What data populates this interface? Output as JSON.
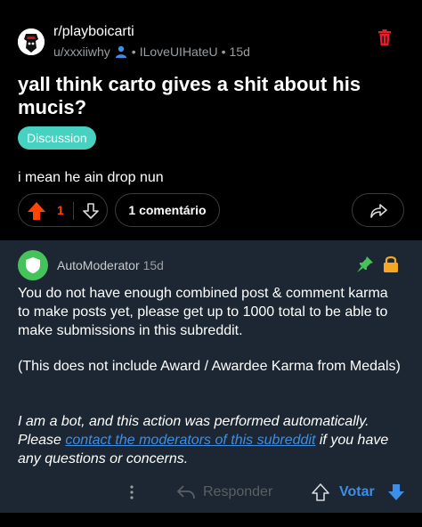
{
  "colors": {
    "background": "#000000",
    "comment_bg": "#1c2733",
    "upvote": "#ff4500",
    "flair": "#46d1c0",
    "link": "#3d8ee6",
    "trash": "#e0202a",
    "mod_avatar": "#46c25b",
    "pin": "#46c25b",
    "lock": "#f5a623"
  },
  "post": {
    "subreddit": "r/playboicarti",
    "author": "u/xxxiiwhy",
    "user_flair": "ILoveUIHateU",
    "age": "15d",
    "title": "yall think carto gives a shit about his mucis?",
    "flair": "Discussion",
    "body": "i mean he ain drop nun",
    "score": "1",
    "comments_label": "1 comentário",
    "icons": {
      "subreddit": "subreddit-avatar-icon",
      "user": "person-icon",
      "delete": "trash-icon",
      "upvote": "upvote-arrow-icon",
      "downvote": "downvote-arrow-icon",
      "share": "share-icon"
    }
  },
  "comment": {
    "author": "AutoModerator",
    "age": "15d",
    "paragraph1": "You do not have enough combined post & comment karma to make posts yet, please get up to 1000 total to be able to make submissions in this subreddit.",
    "paragraph2": "(This does not include Award / Awardee Karma from Medals)",
    "paragraph3_before": "I am a bot, and this action was performed automatically. Please ",
    "paragraph3_link": "contact the moderators of this subreddit",
    "paragraph3_after": " if you have any questions or concerns.",
    "reply_label": "Responder",
    "vote_label": "Votar",
    "icons": {
      "avatar": "shield-icon",
      "pinned": "pin-icon",
      "locked": "lock-icon",
      "more": "more-options-icon",
      "reply": "reply-arrow-icon",
      "upvote": "upvote-outline-icon",
      "downvote": "downvote-filled-icon"
    }
  }
}
